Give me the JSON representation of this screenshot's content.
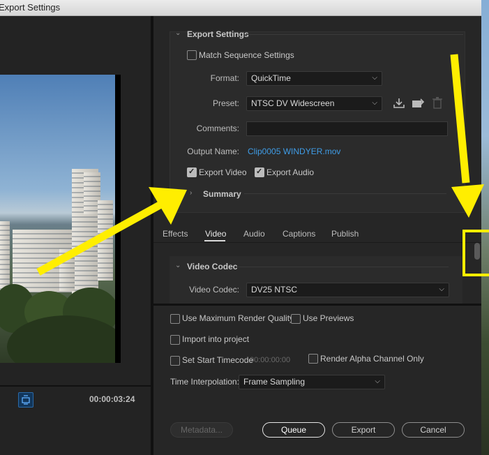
{
  "window": {
    "title": "Export Settings"
  },
  "preview": {
    "timecode": "00:00:03:24"
  },
  "export_settings": {
    "section_title": "Export Settings",
    "match_sequence_label": "Match Sequence Settings",
    "match_sequence_checked": false,
    "format_label": "Format:",
    "format_value": "QuickTime",
    "preset_label": "Preset:",
    "preset_value": "NTSC DV Widescreen",
    "comments_label": "Comments:",
    "comments_value": "",
    "output_name_label": "Output Name:",
    "output_name_value": "Clip0005 WINDYER.mov",
    "export_video_label": "Export Video",
    "export_video_checked": true,
    "export_audio_label": "Export Audio",
    "export_audio_checked": true,
    "summary_label": "Summary"
  },
  "tabs": [
    {
      "label": "Effects",
      "active": false
    },
    {
      "label": "Video",
      "active": true
    },
    {
      "label": "Audio",
      "active": false
    },
    {
      "label": "Captions",
      "active": false
    },
    {
      "label": "Publish",
      "active": false
    }
  ],
  "video_codec": {
    "section_title": "Video Codec",
    "codec_label": "Video Codec:",
    "codec_value": "DV25 NTSC"
  },
  "options": {
    "max_render_quality": "Use Maximum Render Quality",
    "use_previews": "Use Previews",
    "import_into_project": "Import into project",
    "set_start_timecode": "Set Start Timecode",
    "start_timecode_value": "00:00:00:00",
    "render_alpha": "Render Alpha Channel Only",
    "time_interpolation_label": "Time Interpolation:",
    "time_interpolation_value": "Frame Sampling"
  },
  "buttons": {
    "metadata": "Metadata...",
    "queue": "Queue",
    "export": "Export",
    "cancel": "Cancel"
  },
  "colors": {
    "accent_link": "#3f9ce6",
    "annotation_arrow": "#ffee00",
    "panel_bg": "#262626"
  }
}
